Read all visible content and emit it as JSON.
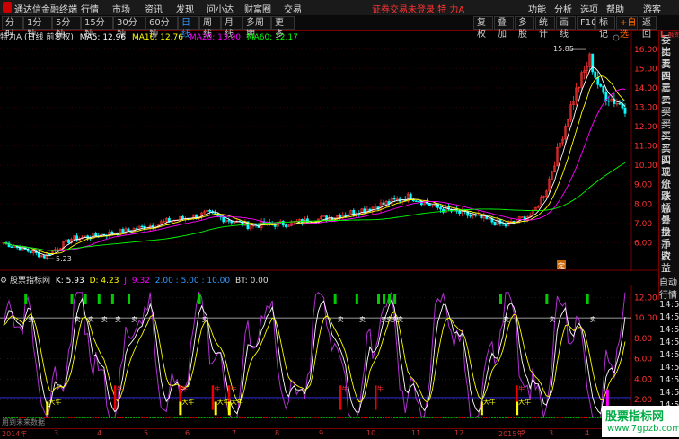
{
  "menubar": {
    "app_title": "通达信金融终端",
    "items": [
      "行情",
      "市场",
      "资讯",
      "发现",
      "问小达",
      "财富圈",
      "交易"
    ],
    "status": "证券交易未登录  特 力A",
    "right_items": [
      "功能",
      "分析",
      "选项",
      "帮助",
      "游客"
    ]
  },
  "toolbar": {
    "left": [
      "分时",
      "1分钟",
      "5分钟",
      "15分钟",
      "30分钟",
      "60分钟",
      "日线",
      "周线",
      "月线",
      "多周期",
      "更多"
    ],
    "active": "日线",
    "right": [
      "复权",
      "叠加",
      "多股",
      "统计",
      "画线",
      "F10",
      "标记",
      "+自选",
      "返回"
    ]
  },
  "price_chart": {
    "title": "特力A (日线 前复权)",
    "ma5": "MA5: 12.96",
    "ma10": "MA10: 12.76",
    "ma20": "MA20: 13.00",
    "ma60": "MA60: 12.17",
    "high_label": "15.85",
    "low_label": "5.23",
    "marker": "定",
    "y_ticks": [
      "16.00",
      "15.00",
      "14.00",
      "13.00",
      "12.00",
      "11.00",
      "10.00",
      "9.00",
      "8.00",
      "7.00",
      "6.00"
    ],
    "colors": {
      "ma5": "#ffffff",
      "ma10": "#ffff00",
      "ma20": "#ff00ff",
      "ma60": "#00ff00",
      "candle_up": "#ff3333",
      "candle_down": "#00ffff"
    }
  },
  "right_panel": {
    "items": [
      "委比",
      "卖五",
      "卖四",
      "卖三",
      "卖二",
      "卖一",
      "买一",
      "买二",
      "买三",
      "买四",
      "买五",
      "现价",
      "涨跌",
      "涨幅",
      "总量",
      "外盘",
      "换手",
      "净资",
      "收益"
    ],
    "tag": "L",
    "tag2": "融资"
  },
  "indicator": {
    "title": "股票指标网",
    "k": "K: 5.93",
    "d": "D: 4.23",
    "j": "J: 9.32",
    "params": "2.00 : 5.00 : 10.00",
    "bt": "BT: 0.00",
    "y_ticks": [
      "12.00",
      "10.00",
      "8.00",
      "6.00",
      "4.00",
      "2.00"
    ],
    "sell_label": "卖",
    "buy_label": "大牛",
    "red_label": "牛",
    "bottom_left": "用到未来数据",
    "time_labels": [
      "自动",
      "行情",
      "14:56",
      "14:56",
      "14:56",
      "14:56",
      "14:56",
      "14:56",
      "14:56",
      "14:56",
      "14:56",
      "14:56"
    ]
  },
  "dates": [
    "2014年",
    "3",
    "4",
    "5",
    "6",
    "7",
    "8",
    "9",
    "10",
    "11",
    "12",
    "2015年",
    "2",
    "3",
    "4",
    "5"
  ],
  "watermark": {
    "line1": "股票指标网",
    "line2": "www.7gpzb.com"
  }
}
